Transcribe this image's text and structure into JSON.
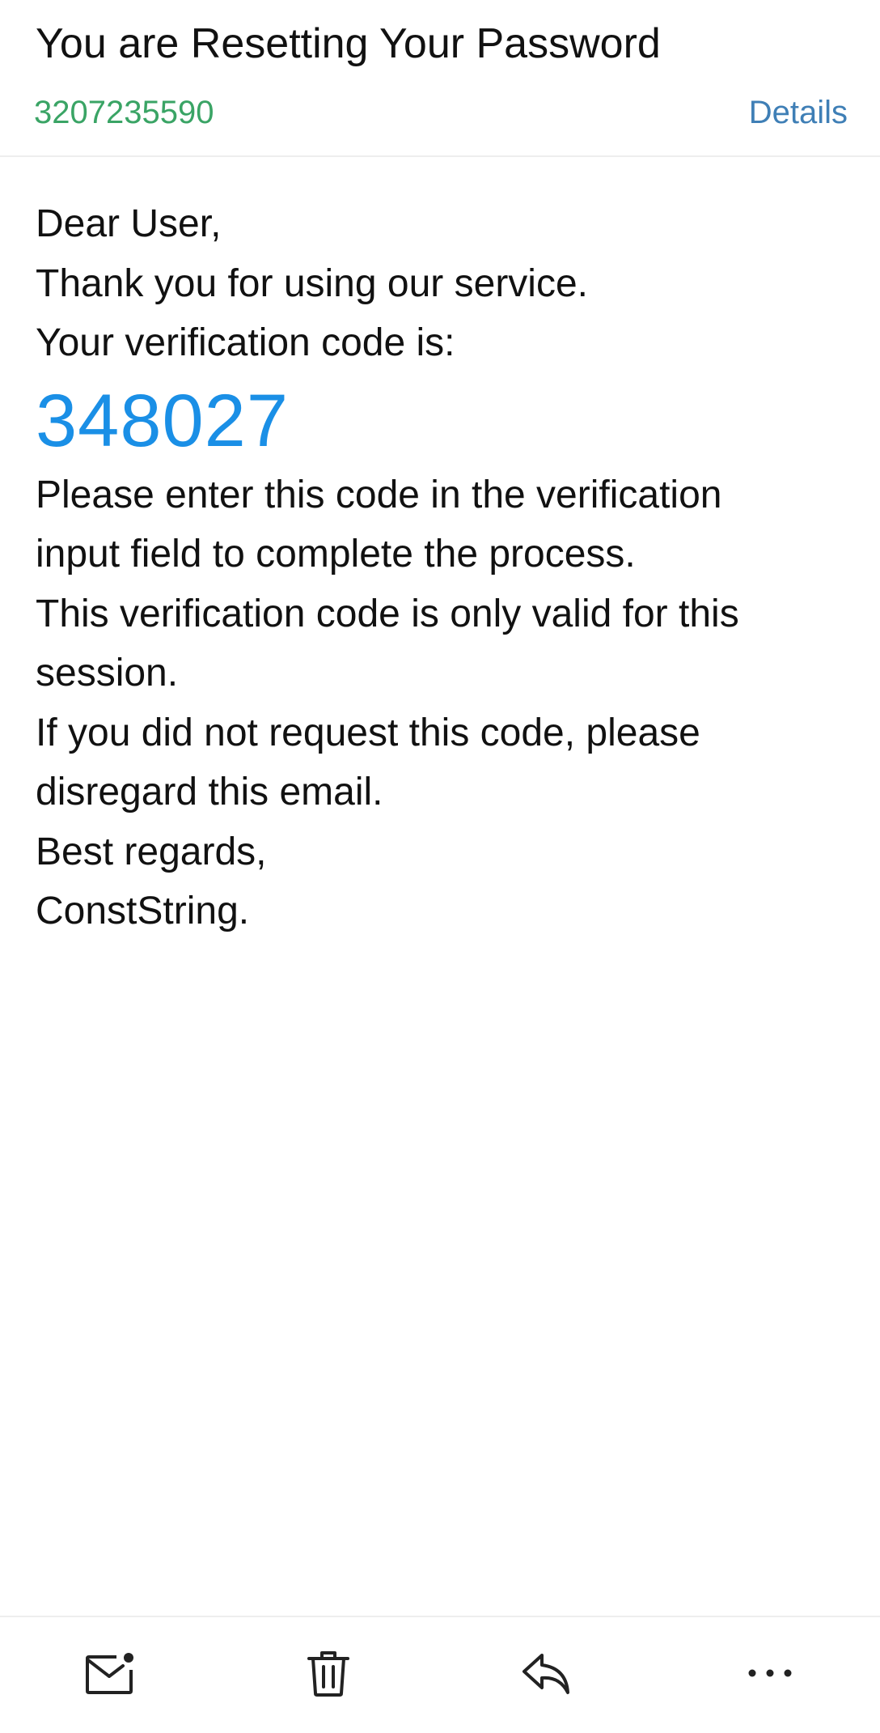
{
  "header": {
    "subject": "You are Resetting Your Password",
    "sender": "3207235590",
    "details_label": "Details"
  },
  "body": {
    "greeting": "Dear User,",
    "thanks": "Thank you for using our service.",
    "code_intro": "Your verification code is:",
    "code": "348027",
    "instruction_1": "Please enter this code in the verification",
    "instruction_2": "input field to complete the process.",
    "validity_1": "This verification code is only valid for this",
    "validity_2": "session.",
    "disregard_1": "If you did not request this code, please",
    "disregard_2": "disregard this email.",
    "closing": "Best regards,",
    "signature": "ConstString."
  },
  "toolbar": {
    "items": [
      {
        "icon": "mark-unread-icon"
      },
      {
        "icon": "delete-icon"
      },
      {
        "icon": "reply-icon"
      },
      {
        "icon": "more-icon"
      }
    ]
  },
  "colors": {
    "sender": "#3aa465",
    "details": "#3f7fb6",
    "code": "#1a8fe6",
    "text": "#111111",
    "divider": "#eeeeee"
  }
}
